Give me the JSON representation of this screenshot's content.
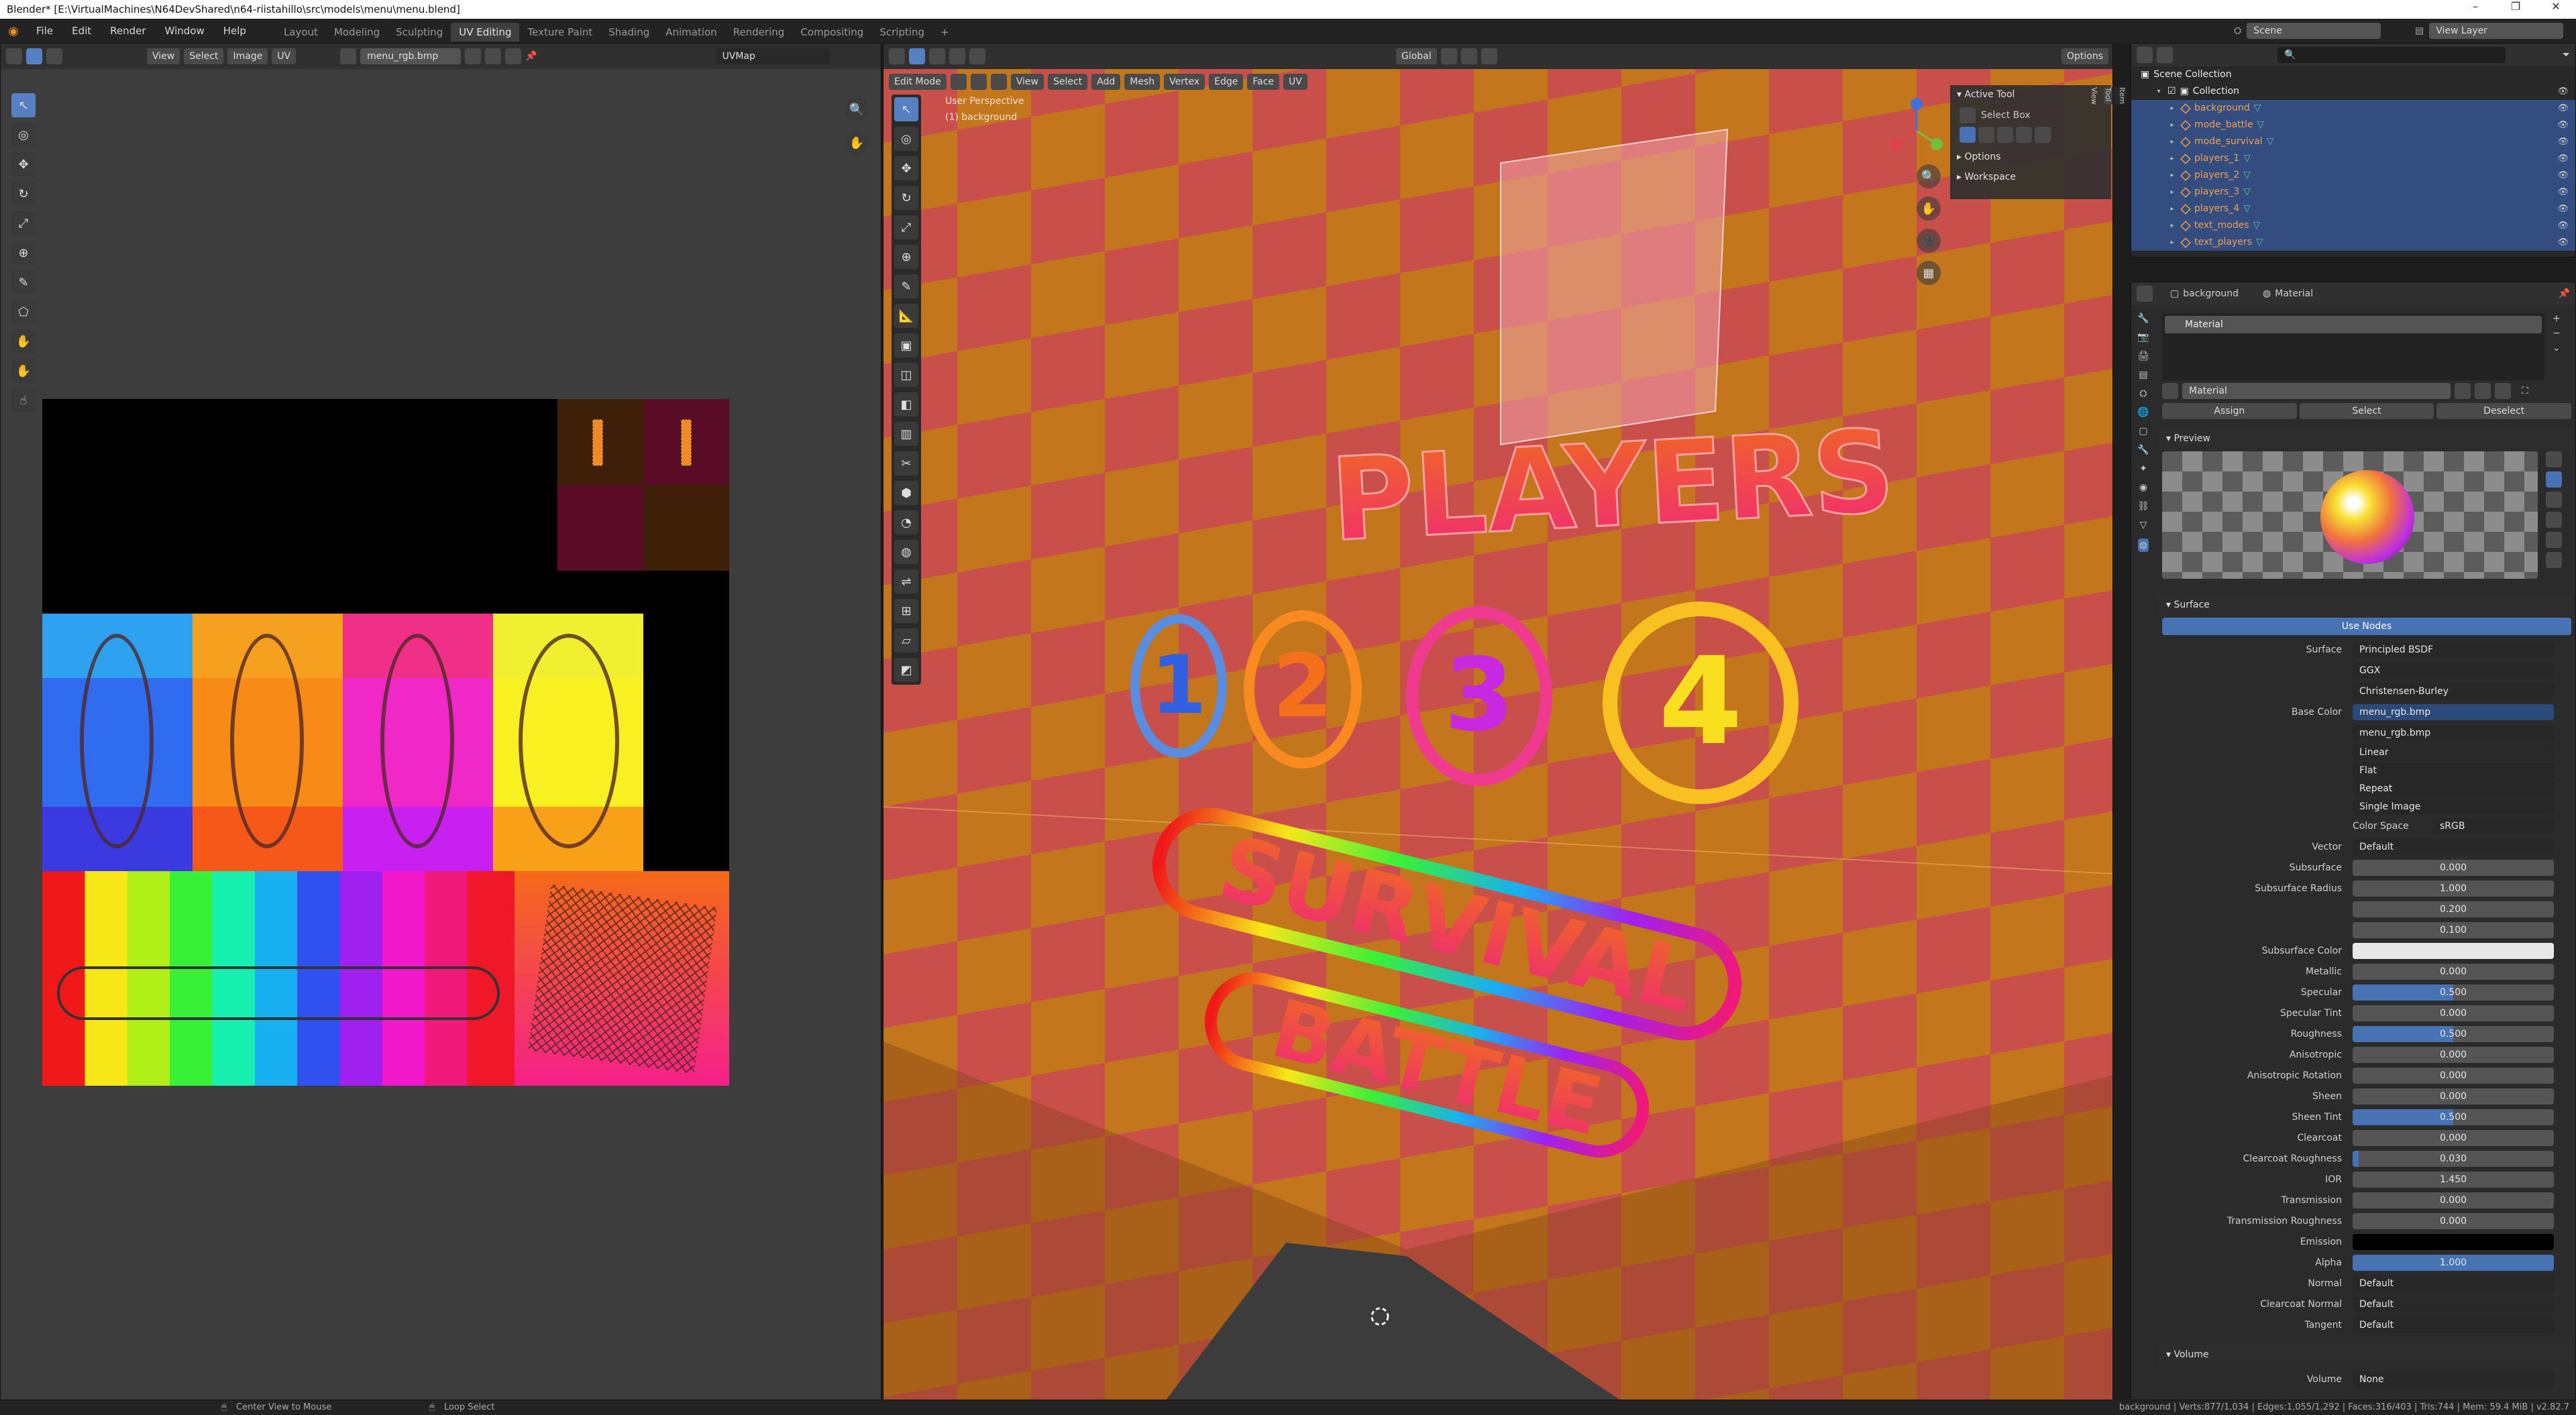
{
  "window": {
    "title": "Blender* [E:\\VirtualMachines\\N64DevShared\\n64-riistahillo\\src\\models\\menu\\menu.blend]",
    "controls": [
      "–",
      "❐",
      "✕"
    ]
  },
  "topbar": {
    "menus": [
      "File",
      "Edit",
      "Render",
      "Window",
      "Help"
    ],
    "workspaces": [
      "Layout",
      "Modeling",
      "Sculpting",
      "UV Editing",
      "Texture Paint",
      "Shading",
      "Animation",
      "Rendering",
      "Compositing",
      "Scripting"
    ],
    "add_tab": "+",
    "scene": "Scene",
    "view_layer": "View Layer"
  },
  "uv_editor": {
    "menus": [
      "View",
      "Select",
      "Image",
      "UV"
    ],
    "image_name": "menu_rgb.bmp",
    "uvmap": "UVMap"
  },
  "viewport": {
    "mode": "Edit Mode",
    "menus": [
      "View",
      "Select",
      "Add",
      "Mesh",
      "Vertex",
      "Edge",
      "Face",
      "UV"
    ],
    "orientation": "Global",
    "options": "Options",
    "overlay_line1": "User Perspective",
    "overlay_line2": "(1) background",
    "n_panel": {
      "active_tool": "Active Tool",
      "select_box": "Select Box",
      "options": "Options",
      "workspace": "Workspace",
      "tabs": [
        "Item",
        "Tool",
        "View"
      ]
    },
    "scene_text": {
      "players": "PLAYERS",
      "n1": "1",
      "n2": "2",
      "n3": "3",
      "n4": "4",
      "survival": "SURVIVAL",
      "battle": "BATTLE"
    }
  },
  "outliner": {
    "scene_collection": "Scene Collection",
    "collection": "Collection",
    "items": [
      "background",
      "mode_battle",
      "mode_survival",
      "players_1",
      "players_2",
      "players_3",
      "players_4",
      "text_modes",
      "text_players"
    ]
  },
  "properties": {
    "object": "background",
    "material_tab": "Material",
    "slot": "Material",
    "material_name": "Material",
    "assign": "Assign",
    "select": "Select",
    "deselect": "Deselect",
    "preview": "Preview",
    "surface_section": "Surface",
    "use_nodes": "Use Nodes",
    "surface_label": "Surface",
    "surface_value": "Principled BSDF",
    "dist1": "GGX",
    "dist2": "Christensen-Burley",
    "base_color_label": "Base Color",
    "base_color_value": "menu_rgb.bmp",
    "image_value": "menu_rgb.bmp",
    "interp": "Linear",
    "projection": "Flat",
    "extension": "Repeat",
    "source": "Single Image",
    "color_space_label": "Color Space",
    "color_space_value": "sRGB",
    "vector_label": "Vector",
    "vector_value": "Default",
    "rows": [
      {
        "label": "Subsurface",
        "value": "0.000",
        "fill": 0
      },
      {
        "label": "Subsurface Radius",
        "value": "1.000",
        "fill": 0
      },
      {
        "label": "",
        "value": "0.200",
        "fill": 0
      },
      {
        "label": "",
        "value": "0.100",
        "fill": 0
      },
      {
        "label": "Subsurface Color",
        "value": "",
        "fill": 0,
        "color": "#e8e8e8"
      },
      {
        "label": "Metallic",
        "value": "0.000",
        "fill": 0
      },
      {
        "label": "Specular",
        "value": "0.500",
        "fill": 0.5
      },
      {
        "label": "Specular Tint",
        "value": "0.000",
        "fill": 0
      },
      {
        "label": "Roughness",
        "value": "0.500",
        "fill": 0.5
      },
      {
        "label": "Anisotropic",
        "value": "0.000",
        "fill": 0
      },
      {
        "label": "Anisotropic Rotation",
        "value": "0.000",
        "fill": 0
      },
      {
        "label": "Sheen",
        "value": "0.000",
        "fill": 0
      },
      {
        "label": "Sheen Tint",
        "value": "0.500",
        "fill": 0.5
      },
      {
        "label": "Clearcoat",
        "value": "0.000",
        "fill": 0
      },
      {
        "label": "Clearcoat Roughness",
        "value": "0.030",
        "fill": 0.03
      },
      {
        "label": "IOR",
        "value": "1.450",
        "fill": 0
      },
      {
        "label": "Transmission",
        "value": "0.000",
        "fill": 0
      },
      {
        "label": "Transmission Roughness",
        "value": "0.000",
        "fill": 0
      },
      {
        "label": "Emission",
        "value": "",
        "fill": 0,
        "color": "#000000"
      },
      {
        "label": "Alpha",
        "value": "1.000",
        "fill": 1
      }
    ],
    "normal_label": "Normal",
    "normal_value": "Default",
    "cc_normal_label": "Clearcoat Normal",
    "cc_normal_value": "Default",
    "tangent_label": "Tangent",
    "tangent_value": "Default",
    "volume_section": "Volume",
    "volume_label": "Volume",
    "volume_value": "None"
  },
  "statusbar": {
    "hint1": "Center View to Mouse",
    "hint2": "Loop Select",
    "stats": "background | Verts:877/1,034 | Edges:1,055/1,292 | Faces:316/403 | Tris:744 | Mem: 59.4 MiB | v2.82.7"
  },
  "colors": {
    "accent": "#4772b3",
    "selection": "#334d80",
    "wall_orange": "#c7741a",
    "wall_red": "#c4504a"
  }
}
